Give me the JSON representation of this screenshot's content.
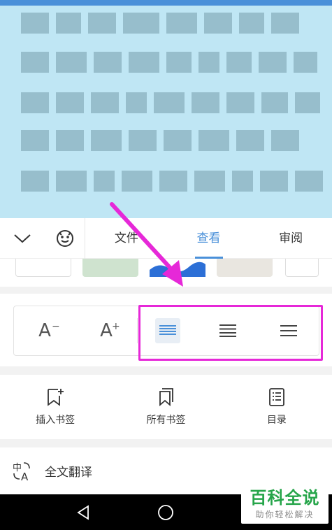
{
  "toolbar": {
    "tabs": [
      {
        "label": "文件"
      },
      {
        "label": "查看"
      },
      {
        "label": "审阅"
      }
    ],
    "active_tab": "查看"
  },
  "font_controls": {
    "decrease_label": "A",
    "decrease_mark": "−",
    "increase_label": "A",
    "increase_mark": "+"
  },
  "bookmarks": {
    "insert_label": "插入书签",
    "all_label": "所有书签",
    "toc_label": "目录"
  },
  "translate": {
    "label": "全文翻译"
  },
  "watermark": {
    "title": "百科全说",
    "subtitle": "助你轻松解决"
  },
  "colors": {
    "accent": "#4a90d9",
    "highlight": "#e628d8",
    "watermark_green": "#26a54a"
  }
}
